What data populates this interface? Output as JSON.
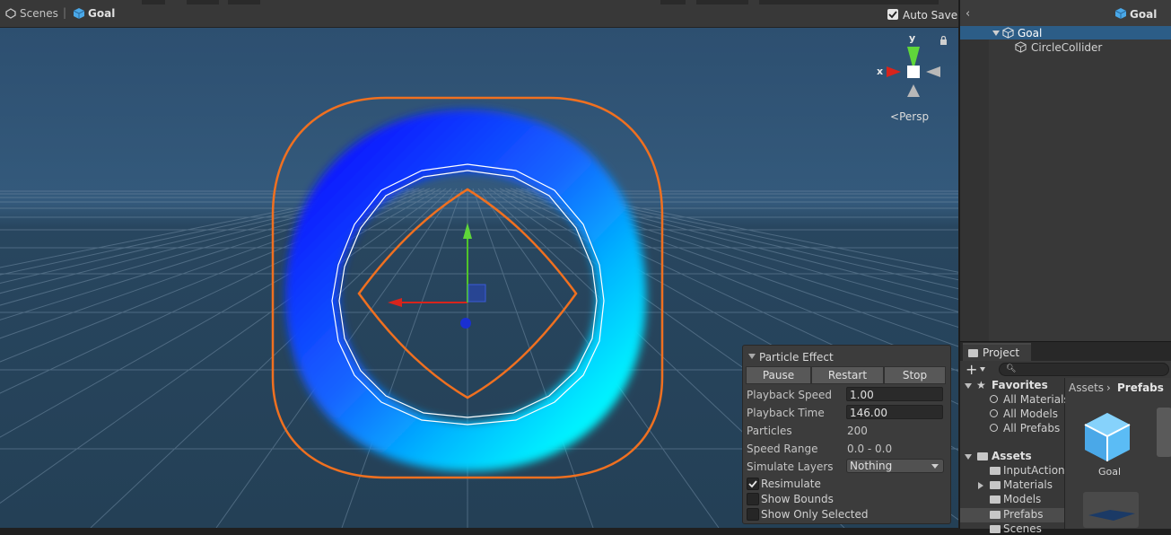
{
  "scene_toolbar": {
    "breadcrumb_scenes": "Scenes",
    "breadcrumb_separator": "|",
    "breadcrumb_goal": "Goal",
    "auto_save_label": "Auto Save",
    "auto_save_checked": true
  },
  "gizmo": {
    "x_label": "x",
    "y_label": "y",
    "projection_label": "Persp"
  },
  "particle_effect": {
    "title": "Particle Effect",
    "buttons": {
      "pause": "Pause",
      "restart": "Restart",
      "stop": "Stop"
    },
    "playback_speed_label": "Playback Speed",
    "playback_speed_value": "1.00",
    "playback_time_label": "Playback Time",
    "playback_time_value": "146.00",
    "particles_label": "Particles",
    "particles_value": "200",
    "speed_range_label": "Speed Range",
    "speed_range_value": "0.0 - 0.0",
    "simulate_layers_label": "Simulate Layers",
    "simulate_layers_value": "Nothing",
    "resimulate_label": "Resimulate",
    "resimulate_checked": true,
    "show_bounds_label": "Show Bounds",
    "show_bounds_checked": false,
    "show_only_selected_label": "Show Only Selected",
    "show_only_selected_checked": false
  },
  "hierarchy": {
    "title": "Goal",
    "items": [
      {
        "label": "Goal",
        "selected": true
      },
      {
        "label": "CircleCollider",
        "selected": false
      }
    ]
  },
  "project": {
    "tab_label": "Project",
    "favorites_label": "Favorites",
    "favorites": [
      "All Materials",
      "All Models",
      "All Prefabs"
    ],
    "assets_label": "Assets",
    "assets_folders": [
      "InputActions",
      "Materials",
      "Models",
      "Prefabs",
      "Scenes"
    ],
    "breadcrumb": [
      "Assets",
      "Prefabs"
    ],
    "asset_items": [
      "Goal"
    ]
  },
  "colors": {
    "scene_background": "#2b4d6b",
    "selection_outline": "#f07020",
    "ring_blue": "#1030ff",
    "ring_cyan": "#00f0ff",
    "selected_row": "#2c5d87"
  }
}
